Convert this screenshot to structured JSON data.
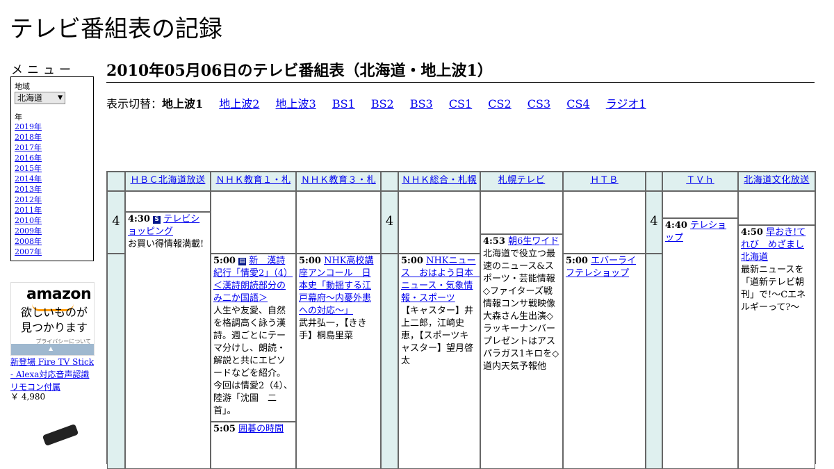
{
  "site": {
    "title": "テレビ番組表の記録"
  },
  "menu": {
    "label": "メニュー",
    "region_label": "地域",
    "region_value": "北海道",
    "year_label": "年",
    "years": [
      "2019年",
      "2018年",
      "2017年",
      "2016年",
      "2015年",
      "2014年",
      "2013年",
      "2012年",
      "2011年",
      "2010年",
      "2009年",
      "2008年",
      "2007年"
    ]
  },
  "ad": {
    "logo": "amazon",
    "tagline": "欲しいものが見つかります",
    "privacy": "プライバシーについて",
    "product": "新登場 Fire TV Stick - Alexa対応音声認識リモコン付属",
    "price": "￥ 4,980"
  },
  "page": {
    "heading": "2010年05月06日のテレビ番組表（北海道・地上波1）"
  },
  "switcher": {
    "label": "表示切替：",
    "current": "地上波1",
    "links": [
      "地上波2",
      "地上波3",
      "BS1",
      "BS2",
      "BS3",
      "CS1",
      "CS2",
      "CS3",
      "CS4",
      "ラジオ1"
    ]
  },
  "hour": "4",
  "channels": [
    "ＨＢＣ北海道放送",
    "ＮＨＫ教育１・札幌",
    "ＮＨＫ教育３・札幌",
    "ＮＨＫ総合・札幌",
    "札幌テレビ",
    "ＨＴＢ",
    "ＴＶｈ",
    "北海道文化放送"
  ],
  "programs": {
    "hbc": {
      "time": "4:30",
      "badge": "S",
      "title": "テレビショッピング",
      "desc": "お買い得情報満載!"
    },
    "edu1a": {
      "time": "5:00",
      "badge": "字",
      "title": "新　漢詩紀行「情愛2」（4）＜漢詩朗読部分のみ二か国語＞",
      "desc": "人生や友愛、自然を格調高く詠う漢詩。週ごとにテーマ分けし、朗読・解説と共にエピソードなどを紹介。今回は情愛2（4）、陸游「沈園　二首」。"
    },
    "edu1b": {
      "time": "5:05",
      "title": "囲碁の時間"
    },
    "edu3": {
      "time": "5:00",
      "title": "NHK高校講座アンコール　日本史「動揺する江戸幕府～内憂外患への対応～」",
      "desc": "武井弘一，【きき手】桐島里菜"
    },
    "nhk": {
      "time": "5:00",
      "title": "NHKニュース　おはよう日本　ニュース・気象情報・スポーツ",
      "desc": "【キャスター】井上二郎，江崎史恵，【スポーツキャスター】望月啓太"
    },
    "stv": {
      "time": "4:53",
      "title": "朝6生ワイド",
      "desc": "北海道で役立つ最速のニュース&スポーツ・芸能情報◇ファイターズ戦情報コンサ戦映像大森さん生出演◇ラッキーナンバープレゼントはアスパラガス1キロを◇道内天気予報他"
    },
    "htb": {
      "time": "5:00",
      "title": "エバーライフテレショップ"
    },
    "tvh": {
      "time": "4:40",
      "title": "テレショップ"
    },
    "uhb": {
      "time": "4:50",
      "title": "早おき!てれび　めざまし北海道",
      "desc": "最新ニュースを「道新テレビ朝刊」で!～Cエネルギーって?～"
    }
  }
}
